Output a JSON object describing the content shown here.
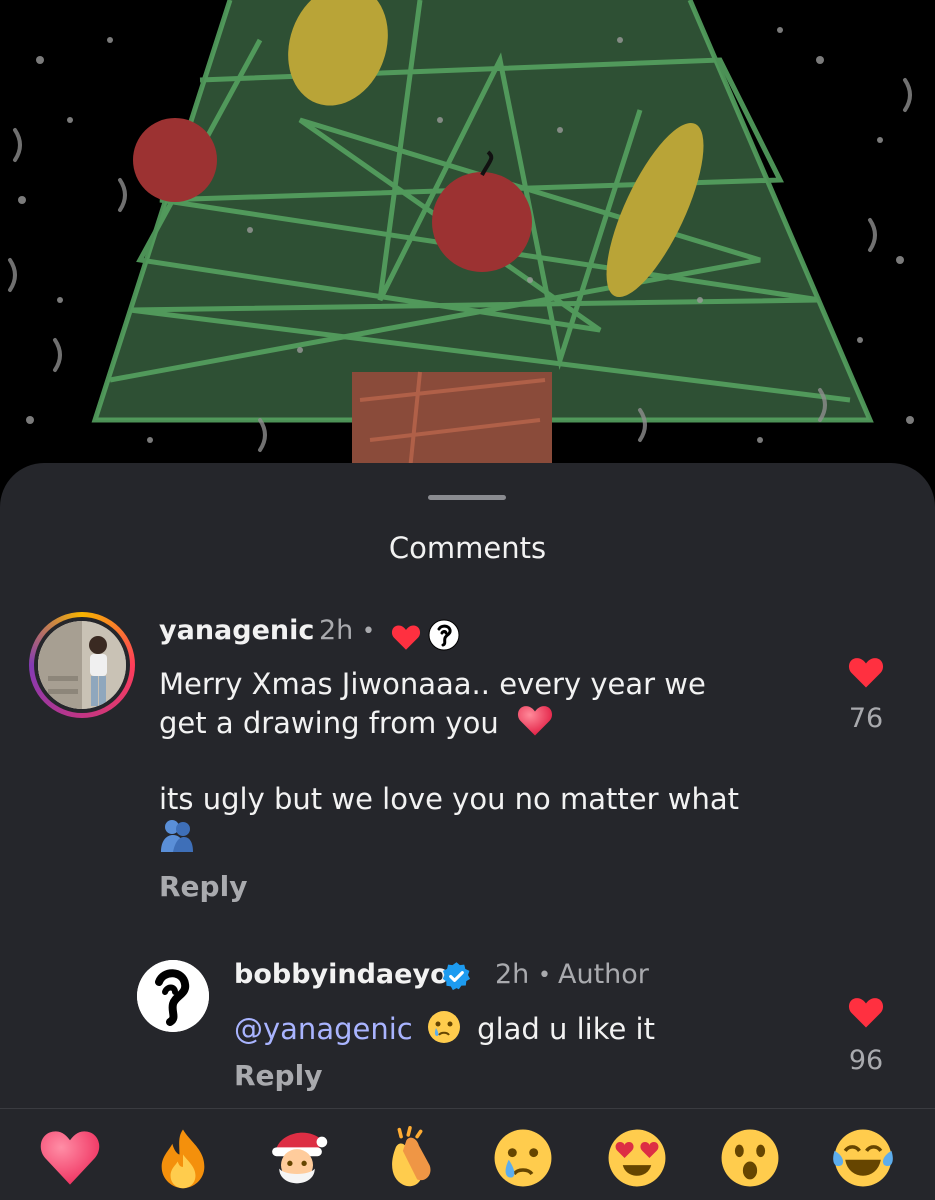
{
  "sheet": {
    "title": "Comments"
  },
  "comments": [
    {
      "username": "yanagenic",
      "time": "2h",
      "separator": "•",
      "body_line1": "Merry Xmas Jiwonaaa.. every year we",
      "body_line2": "get a drawing from you",
      "body_line3": "its ugly but we love you no matter what",
      "reply_label": "Reply",
      "like_count": "76"
    },
    {
      "username": "bobbyindaeyo",
      "time": "2h",
      "separator": "•",
      "author_label": "Author",
      "mention": "@yanagenic",
      "body_text": "glad u like it",
      "reply_label": "Reply",
      "like_count": "96"
    }
  ],
  "quick_reactions": [
    "heart",
    "fire",
    "santa",
    "clapping-hands",
    "crying-face",
    "heart-eyes",
    "surprised-face",
    "tears-of-joy"
  ],
  "colors": {
    "sheet_bg": "#25262b",
    "like_red": "#ff3040",
    "mention_blue": "#a9b4ff",
    "verified_blue": "#1d9bf0",
    "muted_text": "#a9aaae"
  }
}
